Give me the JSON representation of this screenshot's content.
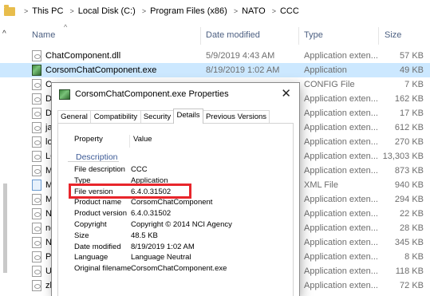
{
  "breadcrumb": [
    "This PC",
    "Local Disk (C:)",
    "Program Files (x86)",
    "NATO",
    "CCC"
  ],
  "columns": {
    "name": "Name",
    "date": "Date modified",
    "type": "Type",
    "size": "Size"
  },
  "files": [
    {
      "name": "ChatComponent.dll",
      "date": "5/9/2019 4:43 AM",
      "type": "Application exten...",
      "size": "57 KB",
      "icon": "dll-file-icon",
      "selected": false
    },
    {
      "name": "CorsomChatComponent.exe",
      "date": "8/19/2019 1:02 AM",
      "type": "Application",
      "size": "49 KB",
      "icon": "exe-file-icon",
      "selected": true
    },
    {
      "name": "Co",
      "date": "",
      "type": "CONFIG File",
      "size": "7 KB",
      "icon": "config-file-icon",
      "selected": false
    },
    {
      "name": "DB",
      "date": "",
      "type": "Application exten...",
      "size": "162 KB",
      "icon": "dll-file-icon",
      "selected": false
    },
    {
      "name": "DB",
      "date": "",
      "type": "Application exten...",
      "size": "17 KB",
      "icon": "dll-file-icon",
      "selected": false
    },
    {
      "name": "jab",
      "date": "",
      "type": "Application exten...",
      "size": "612 KB",
      "icon": "dll-file-icon",
      "selected": false
    },
    {
      "name": "log",
      "date": "",
      "type": "Application exten...",
      "size": "270 KB",
      "icon": "dll-file-icon",
      "selected": false
    },
    {
      "name": "LO",
      "date": "",
      "type": "Application exten...",
      "size": "13,303 KB",
      "icon": "dll-file-icon",
      "selected": false
    },
    {
      "name": "Ma",
      "date": "",
      "type": "Application exten...",
      "size": "873 KB",
      "icon": "dll-file-icon",
      "selected": false
    },
    {
      "name": "Ma",
      "date": "",
      "type": "XML File",
      "size": "940 KB",
      "icon": "xml-file-icon",
      "selected": false
    },
    {
      "name": "Mo",
      "date": "",
      "type": "Application exten...",
      "size": "294 KB",
      "icon": "dll-file-icon",
      "selected": false
    },
    {
      "name": "NL",
      "date": "",
      "type": "Application exten...",
      "size": "22 KB",
      "icon": "dll-file-icon",
      "selected": false
    },
    {
      "name": "ne",
      "date": "",
      "type": "Application exten...",
      "size": "28 KB",
      "icon": "dll-file-icon",
      "selected": false
    },
    {
      "name": "Np",
      "date": "",
      "type": "Application exten...",
      "size": "345 KB",
      "icon": "dll-file-icon",
      "selected": false
    },
    {
      "name": "PG",
      "date": "",
      "type": "Application exten...",
      "size": "8 KB",
      "icon": "dll-file-icon",
      "selected": false
    },
    {
      "name": "Us",
      "date": "",
      "type": "Application exten...",
      "size": "118 KB",
      "icon": "dll-file-icon",
      "selected": false
    },
    {
      "name": "zlit",
      "date": "",
      "type": "Application exten...",
      "size": "72 KB",
      "icon": "dll-file-icon",
      "selected": false
    }
  ],
  "dialog": {
    "title": "CorsomChatComponent.exe Properties",
    "close_glyph": "✕",
    "tabs": [
      "General",
      "Compatibility",
      "Security",
      "Details",
      "Previous Versions"
    ],
    "active_tab": "Details",
    "table_headers": {
      "property": "Property",
      "value": "Value"
    },
    "section": "Description",
    "properties": [
      {
        "key": "File description",
        "value": "CCC"
      },
      {
        "key": "Type",
        "value": "Application"
      },
      {
        "key": "File version",
        "value": "6.4.0.31502",
        "highlighted": true
      },
      {
        "key": "Product name",
        "value": "CorsomChatComponent"
      },
      {
        "key": "Product version",
        "value": "6.4.0.31502"
      },
      {
        "key": "Copyright",
        "value": "Copyright © 2014 NCI Agency"
      },
      {
        "key": "Size",
        "value": "48.5 KB"
      },
      {
        "key": "Date modified",
        "value": "8/19/2019 1:02 AM"
      },
      {
        "key": "Language",
        "value": "Language Neutral"
      },
      {
        "key": "Original filename",
        "value": "CorsomChatComponent.exe"
      }
    ]
  },
  "colors": {
    "selection": "#cce8ff",
    "highlight_box": "#e8252b",
    "section_text": "#3c5a96",
    "folder": "#e8bd4c"
  }
}
